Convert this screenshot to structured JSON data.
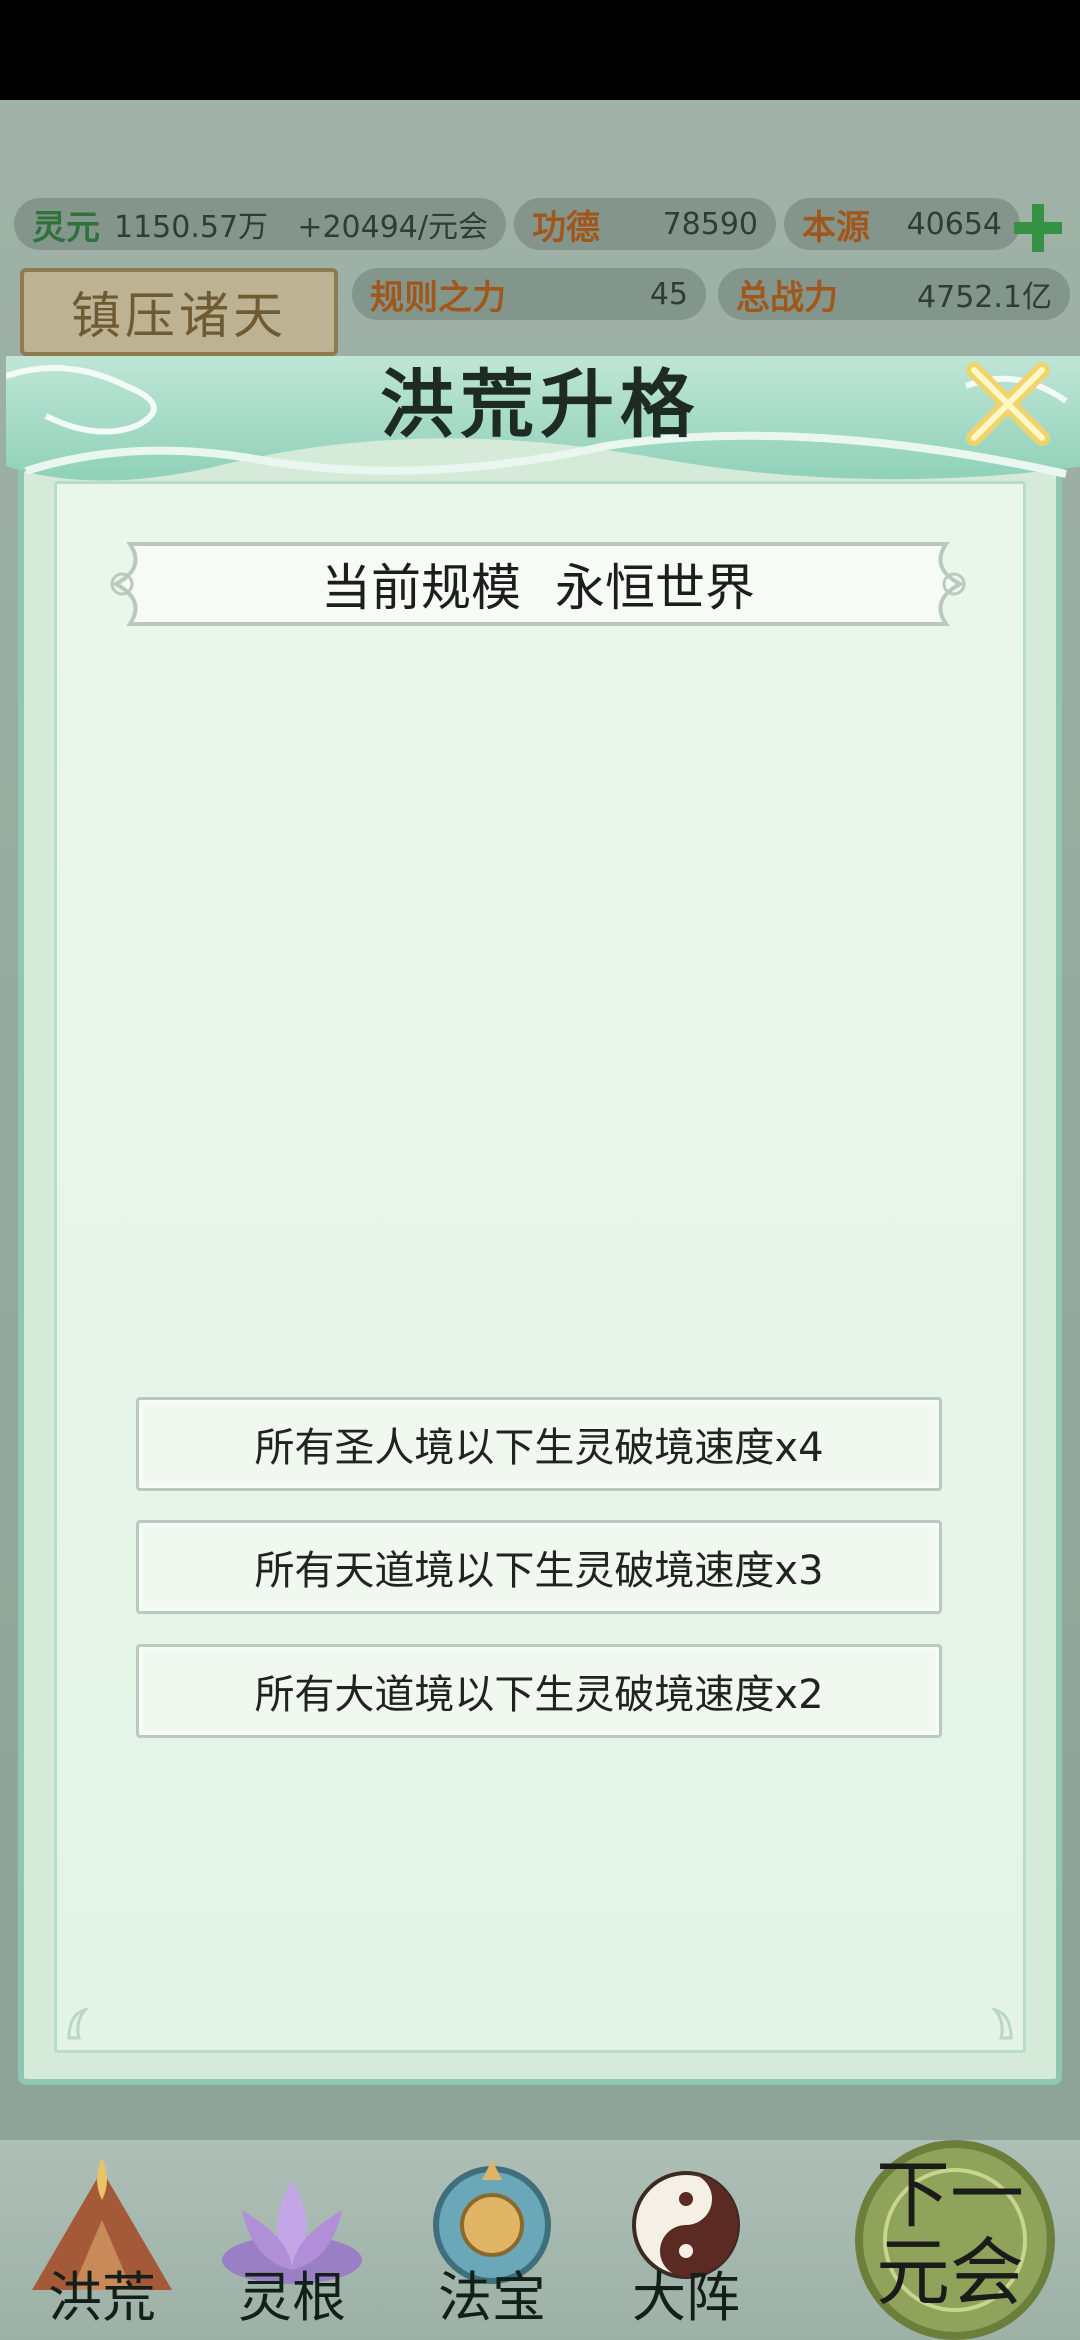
{
  "stats": {
    "lingyuan_label": "灵元",
    "lingyuan_value": "1150.57万",
    "rate": "+20494/元会",
    "gongde_label": "功德",
    "gongde_value": "78590",
    "benyuan_label": "本源",
    "benyuan_value": "40654",
    "guize_label": "规则之力",
    "guize_value": "45",
    "zhanli_label": "总战力",
    "zhanli_value": "4752.1亿"
  },
  "side_button": {
    "label": "镇压诸天"
  },
  "modal": {
    "title": "洪荒升格",
    "scale_label": "当前规模",
    "scale_value": "永恒世界",
    "bonuses": [
      "所有圣人境以下生灵破境速度x4",
      "所有天道境以下生灵破境速度x3",
      "所有大道境以下生灵破境速度x2"
    ]
  },
  "nav": {
    "items": [
      {
        "label": "洪荒",
        "icon": "mountain-flame-icon"
      },
      {
        "label": "灵根",
        "icon": "lotus-icon"
      },
      {
        "label": "法宝",
        "icon": "treasure-orb-icon"
      },
      {
        "label": "大阵",
        "icon": "yin-yang-icon"
      }
    ],
    "next_line1": "下一",
    "next_line2": "元会"
  },
  "colors": {
    "modal_border": "#8fc7b3",
    "modal_bg": "#e4f3e7",
    "stat_green": "#2e7b3a",
    "stat_orange": "#b85a12"
  }
}
